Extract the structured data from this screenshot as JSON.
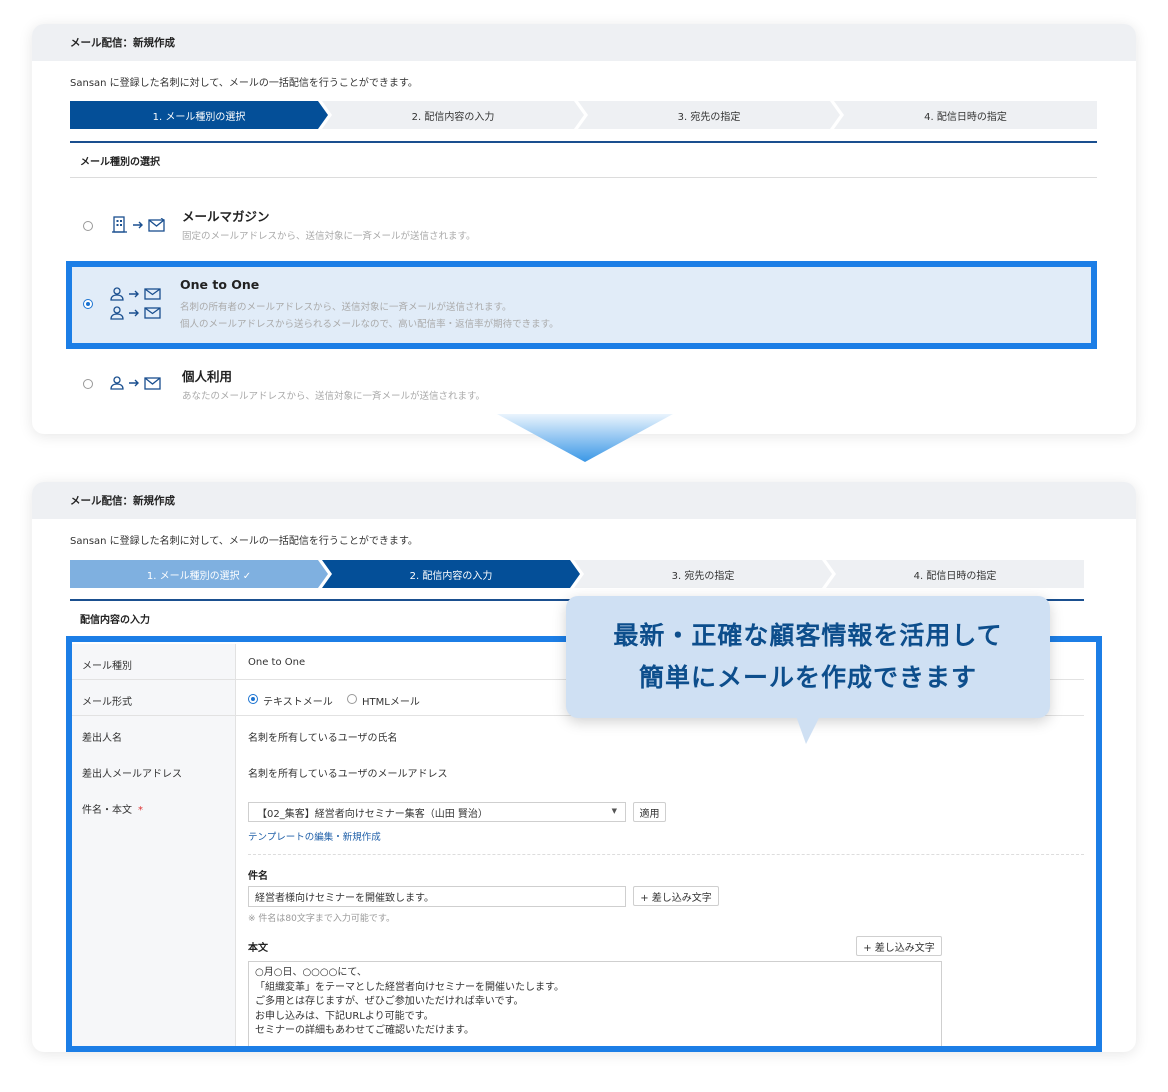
{
  "panel1": {
    "header": "メール配信：新規作成",
    "description": "Sansan に登録した名刺に対して、メールの一括配信を行うことができます。",
    "steps": [
      "1. メール種別の選択",
      "2. 配信内容の入力",
      "3. 宛先の指定",
      "4. 配信日時の指定"
    ],
    "section_title": "メール種別の選択",
    "options": [
      {
        "title": "メールマガジン",
        "desc": [
          "固定のメールアドレスから、送信対象に一斉メールが送信されます。"
        ],
        "selected": false
      },
      {
        "title": "One to One",
        "desc": [
          "名刺の所有者のメールアドレスから、送信対象に一斉メールが送信されます。",
          "個人のメールアドレスから送られるメールなので、高い配信率・返信率が期待できます。"
        ],
        "selected": true
      },
      {
        "title": "個人利用",
        "desc": [
          "あなたのメールアドレスから、送信対象に一斉メールが送信されます。"
        ],
        "selected": false
      }
    ]
  },
  "panel2": {
    "header": "メール配信：新規作成",
    "description": "Sansan に登録した名刺に対して、メールの一括配信を行うことができます。",
    "steps": [
      "1. メール種別の選択 ✓",
      "2. 配信内容の入力",
      "3. 宛先の指定",
      "4. 配信日時の指定"
    ],
    "section_title": "配信内容の入力",
    "form": {
      "mail_type_label": "メール種別",
      "mail_type_value": "One to One",
      "mail_format_label": "メール形式",
      "format_text": "テキストメール",
      "format_html": "HTMLメール",
      "sender_name_label": "差出人名",
      "sender_name_value": "名刺を所有しているユーザの氏名",
      "sender_address_label": "差出人メールアドレス",
      "sender_address_value": "名刺を所有しているユーザのメールアドレス",
      "subject_body_label": "件名・本文",
      "required_mark": "*",
      "template_select": "【02_集客】経営者向けセミナー集客（山田 賢治）",
      "apply_button": "適用",
      "template_link": "テンプレートの編集・新規作成",
      "subject_label": "件名",
      "subject_value": "経営者様向けセミナーを開催致します。",
      "insert_button": "+ 差し込み文字",
      "subject_note": "※ 件名は80文字まで入力可能です。",
      "body_label": "本文",
      "body_lines": [
        "○月○日、○○○○にて、",
        "「組織変革」をテーマとした経営者向けセミナーを開催いたします。",
        "ご多用とは存じますが、ぜひご参加いただければ幸いです。",
        "お申し込みは、下記URLより可能です。",
        "セミナーの詳細もあわせてご確認いただけます。"
      ]
    }
  },
  "callout": {
    "line1": "最新・正確な顧客情報を活用して",
    "line2": "簡単にメールを作成できます"
  },
  "colors": {
    "accent": "#1c7ee6",
    "step_active": "#044f98",
    "step_done": "#7fb0e0",
    "callout_bg": "#cfe0f3"
  }
}
